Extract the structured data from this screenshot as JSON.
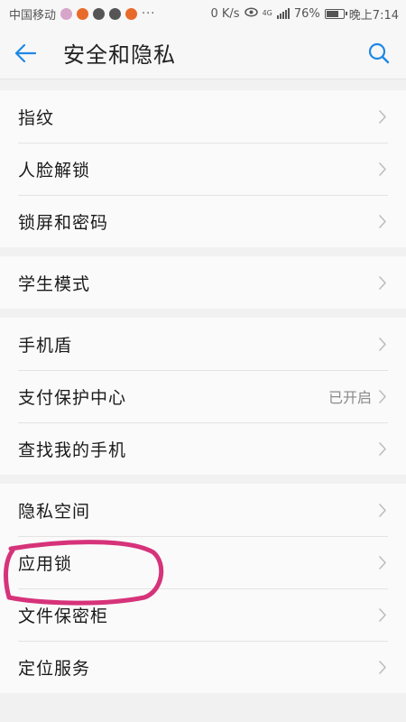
{
  "status_bar": {
    "carrier": "中国移动",
    "speed": "0 K/s",
    "network": "4G",
    "battery": "76%",
    "battery_level": 0.76,
    "time": "晚上7:14",
    "more": "···"
  },
  "header": {
    "title": "安全和隐私"
  },
  "groups": [
    {
      "items": [
        {
          "label": "指纹"
        },
        {
          "label": "人脸解锁"
        },
        {
          "label": "锁屏和密码"
        }
      ]
    },
    {
      "items": [
        {
          "label": "学生模式"
        }
      ]
    },
    {
      "items": [
        {
          "label": "手机盾"
        },
        {
          "label": "支付保护中心",
          "value": "已开启"
        },
        {
          "label": "查找我的手机"
        }
      ]
    },
    {
      "items": [
        {
          "label": "隐私空间"
        },
        {
          "label": "应用锁"
        },
        {
          "label": "文件保密柜"
        },
        {
          "label": "定位服务"
        }
      ]
    }
  ],
  "colors": {
    "accent": "#1e88e5",
    "annotation": "#d6337a"
  }
}
